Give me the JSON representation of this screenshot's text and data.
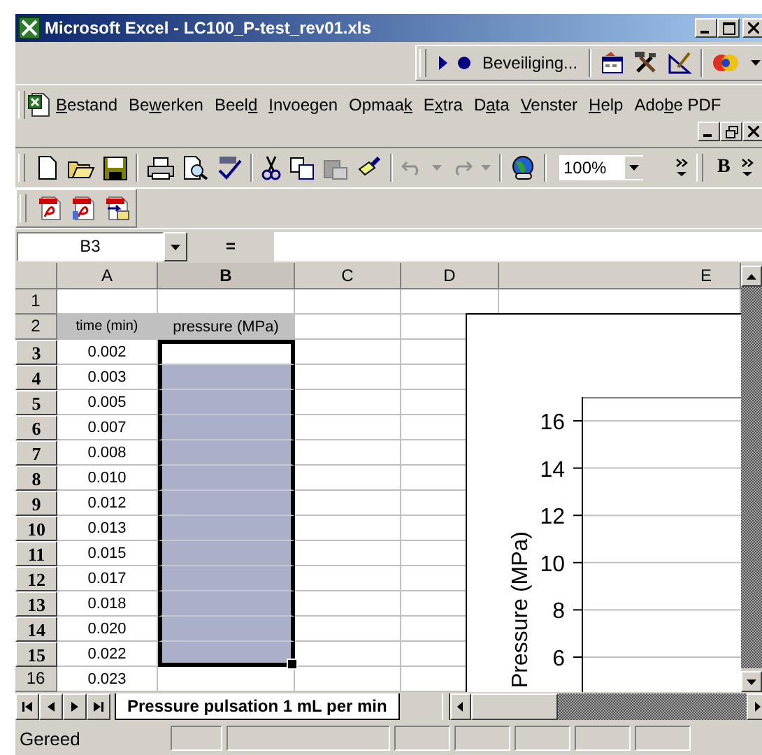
{
  "window": {
    "title": "Microsoft Excel - LC100_P-test_rev01.xls"
  },
  "security_toolbar": {
    "label": "Beveiliging..."
  },
  "menu": [
    {
      "key": "B",
      "after": "estand"
    },
    {
      "before": "Be",
      "key": "w",
      "after": "erken"
    },
    {
      "before": "Beel",
      "key": "d"
    },
    {
      "key": "I",
      "after": "nvoegen"
    },
    {
      "before": "Opmaa",
      "key": "k"
    },
    {
      "before": "E",
      "key": "x",
      "after": "tra"
    },
    {
      "before": "D",
      "key": "a",
      "after": "ta"
    },
    {
      "key": "V",
      "after": "enster"
    },
    {
      "key": "H",
      "after": "elp"
    },
    {
      "before": "Ado",
      "key": "b",
      "after": "e PDF"
    }
  ],
  "standard_toolbar": {
    "zoom": "100%",
    "bold": "B"
  },
  "formula_bar": {
    "name_box": "B3",
    "equals": "="
  },
  "columns": [
    {
      "label": "A",
      "selected": false
    },
    {
      "label": "B",
      "selected": true
    },
    {
      "label": "C",
      "selected": false
    },
    {
      "label": "D",
      "selected": false
    },
    {
      "label": "E",
      "selected": false
    }
  ],
  "rows": [
    {
      "header": "1",
      "selected": false,
      "kind": "data",
      "b_selected": false,
      "b_active": false
    },
    {
      "header": "2",
      "selected": false,
      "kind": "heading",
      "a": "time (min)",
      "b": "pressure (MPa)",
      "b_selected": false,
      "b_active": false
    },
    {
      "header": "3",
      "selected": true,
      "kind": "data",
      "a": "0.002",
      "b_selected": true,
      "b_active": true
    },
    {
      "header": "4",
      "selected": true,
      "kind": "data",
      "a": "0.003",
      "b_selected": true,
      "b_active": false
    },
    {
      "header": "5",
      "selected": true,
      "kind": "data",
      "a": "0.005",
      "b_selected": true,
      "b_active": false
    },
    {
      "header": "6",
      "selected": true,
      "kind": "data",
      "a": "0.007",
      "b_selected": true,
      "b_active": false
    },
    {
      "header": "7",
      "selected": true,
      "kind": "data",
      "a": "0.008",
      "b_selected": true,
      "b_active": false
    },
    {
      "header": "8",
      "selected": true,
      "kind": "data",
      "a": "0.010",
      "b_selected": true,
      "b_active": false
    },
    {
      "header": "9",
      "selected": true,
      "kind": "data",
      "a": "0.012",
      "b_selected": true,
      "b_active": false
    },
    {
      "header": "10",
      "selected": true,
      "kind": "data",
      "a": "0.013",
      "b_selected": true,
      "b_active": false
    },
    {
      "header": "11",
      "selected": true,
      "kind": "data",
      "a": "0.015",
      "b_selected": true,
      "b_active": false
    },
    {
      "header": "12",
      "selected": true,
      "kind": "data",
      "a": "0.017",
      "b_selected": true,
      "b_active": false
    },
    {
      "header": "13",
      "selected": true,
      "kind": "data",
      "a": "0.018",
      "b_selected": true,
      "b_active": false
    },
    {
      "header": "14",
      "selected": true,
      "kind": "data",
      "a": "0.020",
      "b_selected": true,
      "b_active": false
    },
    {
      "header": "15",
      "selected": true,
      "kind": "data",
      "a": "0.022",
      "b_selected": true,
      "b_active": false
    },
    {
      "header": "16",
      "selected": false,
      "kind": "data",
      "a": "0.023",
      "b_selected": false,
      "b_active": false
    }
  ],
  "chart": {
    "ylabel": "Pressure (MPa)",
    "yticks": [
      "16",
      "14",
      "12",
      "10",
      "8",
      "6"
    ]
  },
  "sheet_tabs": [
    {
      "label": "Pressure pulsation 1 mL per min",
      "selected": true
    }
  ],
  "status_bar": {
    "text": "Gereed"
  }
}
